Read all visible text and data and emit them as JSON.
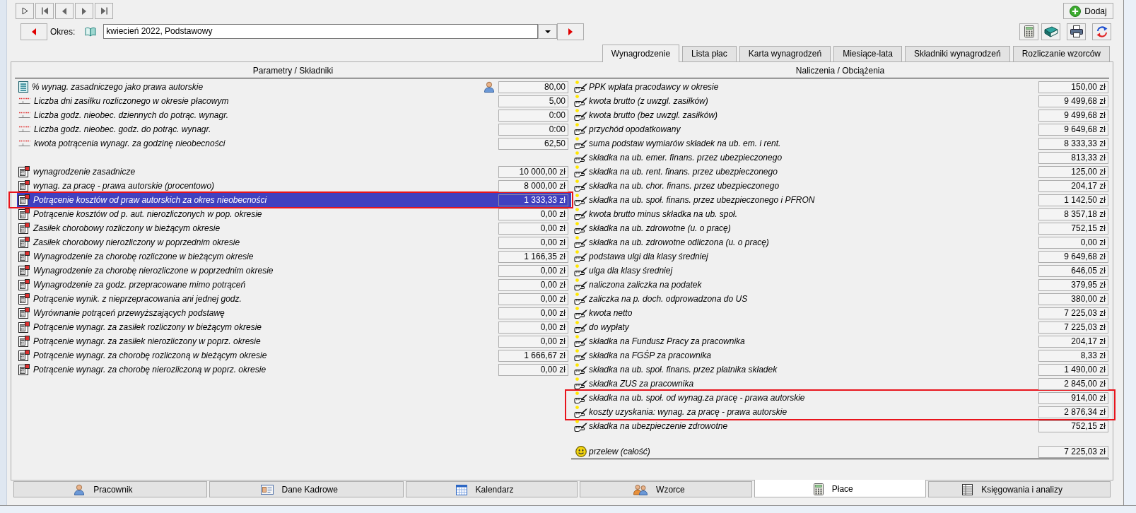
{
  "toolbar": {
    "add_button": "Dodaj",
    "period_label": "Okres:",
    "period_value": "kwiecień 2022, Podstawowy"
  },
  "tabs": [
    {
      "label": "Wynagrodzenie",
      "selected": true
    },
    {
      "label": "Lista płac",
      "selected": false
    },
    {
      "label": "Karta wynagrodzeń",
      "selected": false
    },
    {
      "label": "Miesiące-lata",
      "selected": false
    },
    {
      "label": "Składniki wynagrodzeń",
      "selected": false
    },
    {
      "label": "Rozliczanie wzorców",
      "selected": false
    }
  ],
  "parameters": {
    "title": "Parametry / Składniki",
    "sections": [
      {
        "rows": [
          {
            "kind": "setting",
            "label": "% wynag. zasadniczego jako prawa autorskie",
            "value": "80,00",
            "selected": false,
            "highlighted": false
          },
          {
            "kind": "measure",
            "label": "Liczba dni zasiłku rozliczonego w okresie płacowym",
            "value": "5,00",
            "selected": false,
            "highlighted": false
          },
          {
            "kind": "measure",
            "label": "Liczba godz. nieobec. dziennych do potrąc. wynagr.",
            "value": "0:00",
            "selected": false,
            "highlighted": false
          },
          {
            "kind": "measure",
            "label": "Liczba godz. nieobec. godz. do potrąc. wynagr.",
            "value": "0:00",
            "selected": false,
            "highlighted": false
          },
          {
            "kind": "measure",
            "label": "kwota potrącenia wynagr. za godzinę nieobecności",
            "value": "62,50",
            "selected": false,
            "highlighted": false
          }
        ]
      },
      {
        "rows": [
          {
            "kind": "component",
            "label": "wynagrodzenie zasadnicze",
            "value": "10 000,00 zł",
            "selected": false,
            "highlighted": false
          },
          {
            "kind": "component",
            "label": "wynag. za pracę - prawa autorskie (procentowo)",
            "value": "8 000,00 zł",
            "selected": false,
            "highlighted": false
          },
          {
            "kind": "component",
            "label": "Potrącenie kosztów od praw autorskich za okres nieobecności",
            "value": "1 333,33 zł",
            "selected": true,
            "highlighted": true
          },
          {
            "kind": "component",
            "label": "Potrącenie kosztów od p. aut. nierozliczonych w pop. okresie",
            "value": "0,00 zł",
            "selected": false,
            "highlighted": false
          },
          {
            "kind": "component",
            "label": "Zasiłek chorobowy rozliczony w bieżącym okresie",
            "value": "0,00 zł",
            "selected": false,
            "highlighted": false
          },
          {
            "kind": "component",
            "label": "Zasiłek chorobowy nierozliczony w poprzednim okresie",
            "value": "0,00 zł",
            "selected": false,
            "highlighted": false
          },
          {
            "kind": "component",
            "label": "Wynagrodzenie za chorobę rozliczone w bieżącym okresie",
            "value": "1 166,35 zł",
            "selected": false,
            "highlighted": false
          },
          {
            "kind": "component",
            "label": "Wynagrodzenie za chorobę nierozliczone w poprzednim okresie",
            "value": "0,00 zł",
            "selected": false,
            "highlighted": false
          },
          {
            "kind": "component",
            "label": "Wynagrodzenie za godz. przepracowane mimo potrąceń",
            "value": "0,00 zł",
            "selected": false,
            "highlighted": false
          },
          {
            "kind": "component",
            "label": "Potrącenie wynik. z nieprzepracowania ani jednej godz.",
            "value": "0,00 zł",
            "selected": false,
            "highlighted": false
          },
          {
            "kind": "component",
            "label": "Wyrównanie potrąceń przewyższających podstawę",
            "value": "0,00 zł",
            "selected": false,
            "highlighted": false
          },
          {
            "kind": "component",
            "label": "Potrącenie wynagr. za zasiłek rozliczony w bieżącym okresie",
            "value": "0,00 zł",
            "selected": false,
            "highlighted": false
          },
          {
            "kind": "component",
            "label": "Potrącenie wynagr. za zasiłek nierozliczony w poprz. okresie",
            "value": "0,00 zł",
            "selected": false,
            "highlighted": false
          },
          {
            "kind": "component",
            "label": "Potrącenie wynagr. za chorobę rozliczoną w bieżącym okresie",
            "value": "1 666,67 zł",
            "selected": false,
            "highlighted": false
          },
          {
            "kind": "component",
            "label": "Potrącenie wynagr. za chorobę nierozliczoną w poprz. okresie",
            "value": "0,00 zł",
            "selected": false,
            "highlighted": false
          }
        ]
      }
    ]
  },
  "charges": {
    "title": "Naliczenia / Obciążenia",
    "sections": [
      {
        "rows": [
          {
            "kind": "accrual",
            "label": "PPK wpłata pracodawcy w okresie",
            "value": "150,00 zł",
            "highlighted": false
          },
          {
            "kind": "accrual",
            "label": "kwota brutto (z uwzgl. zasiłków)",
            "value": "9 499,68 zł",
            "highlighted": false
          },
          {
            "kind": "accrual",
            "label": "kwota brutto (bez uwzgl. zasiłków)",
            "value": "9 499,68 zł",
            "highlighted": false
          },
          {
            "kind": "accrual",
            "label": "przychód opodatkowany",
            "value": "9 649,68 zł",
            "highlighted": false
          },
          {
            "kind": "accrual",
            "label": "suma podstaw wymiarów składek na ub. em. i rent.",
            "value": "8 333,33 zł",
            "highlighted": false
          },
          {
            "kind": "accrual",
            "label": "składka na ub. emer. finans. przez ubezpieczonego",
            "value": "813,33 zł",
            "highlighted": false
          },
          {
            "kind": "accrual",
            "label": "składka na ub. rent. finans. przez ubezpieczonego",
            "value": "125,00 zł",
            "highlighted": false
          },
          {
            "kind": "accrual",
            "label": "składka na ub. chor. finans. przez ubezpieczonego",
            "value": "204,17 zł",
            "highlighted": false
          },
          {
            "kind": "accrual",
            "label": "składka na ub. społ. finans. przez ubezpieczonego i PFRON",
            "value": "1 142,50 zł",
            "highlighted": false
          },
          {
            "kind": "accrual",
            "label": "kwota brutto minus składka na ub. społ.",
            "value": "8 357,18 zł",
            "highlighted": false
          },
          {
            "kind": "accrual",
            "label": "składka na ub. zdrowotne (u. o pracę)",
            "value": "752,15 zł",
            "highlighted": false
          },
          {
            "kind": "accrual",
            "label": "składka na ub. zdrowotne odliczona (u. o pracę)",
            "value": "0,00 zł",
            "highlighted": false
          },
          {
            "kind": "accrual",
            "label": "podstawa ulgi dla klasy średniej",
            "value": "9 649,68 zł",
            "highlighted": false
          },
          {
            "kind": "accrual",
            "label": "ulga dla klasy średniej",
            "value": "646,05 zł",
            "highlighted": false
          },
          {
            "kind": "accrual",
            "label": "naliczona zaliczka na podatek",
            "value": "379,95 zł",
            "highlighted": false
          },
          {
            "kind": "accrual",
            "label": "zaliczka na p. doch. odprowadzona do US",
            "value": "380,00 zł",
            "highlighted": false
          },
          {
            "kind": "accrual",
            "label": "kwota netto",
            "value": "7 225,03 zł",
            "highlighted": false
          },
          {
            "kind": "accrual",
            "label": "do wypłaty",
            "value": "7 225,03 zł",
            "highlighted": false
          },
          {
            "kind": "accrual",
            "label": "składka na Fundusz Pracy za pracownika",
            "value": "204,17 zł",
            "highlighted": false
          },
          {
            "kind": "accrual",
            "label": "składka na FGŚP za pracownika",
            "value": "8,33 zł",
            "highlighted": false
          },
          {
            "kind": "accrual",
            "label": "składka na ub. społ. finans. przez płatnika składek",
            "value": "1 490,00 zł",
            "highlighted": false
          },
          {
            "kind": "accrual",
            "label": "składka ZUS za pracownika",
            "value": "2 845,00 zł",
            "highlighted": false
          },
          {
            "kind": "accrual",
            "label": "składka na ub. społ. od wynag.za pracę - prawa autorskie",
            "value": "914,00 zł",
            "highlighted": true
          },
          {
            "kind": "accrual",
            "label": "koszty uzyskania: wynag. za pracę - prawa autorskie",
            "value": "2 876,34 zł",
            "highlighted": true
          },
          {
            "kind": "accrual",
            "label": "składka na ubezpieczenie zdrowotne",
            "value": "752,15 zł",
            "highlighted": false
          }
        ]
      },
      {
        "rows": [
          {
            "kind": "transfer",
            "label": "przelew (całość)",
            "value": "7 225,03 zł",
            "highlighted": false
          }
        ]
      }
    ]
  },
  "bottom_tabs": [
    {
      "kind": "employee",
      "label": "Pracownik",
      "selected": false
    },
    {
      "kind": "staff",
      "label": "Dane Kadrowe",
      "selected": false
    },
    {
      "kind": "calendar",
      "label": "Kalendarz",
      "selected": false
    },
    {
      "kind": "templates",
      "label": "Wzorce",
      "selected": false
    },
    {
      "kind": "payroll",
      "label": "Płace",
      "selected": true
    },
    {
      "kind": "accounting",
      "label": "Księgowania i analizy",
      "selected": false
    }
  ]
}
